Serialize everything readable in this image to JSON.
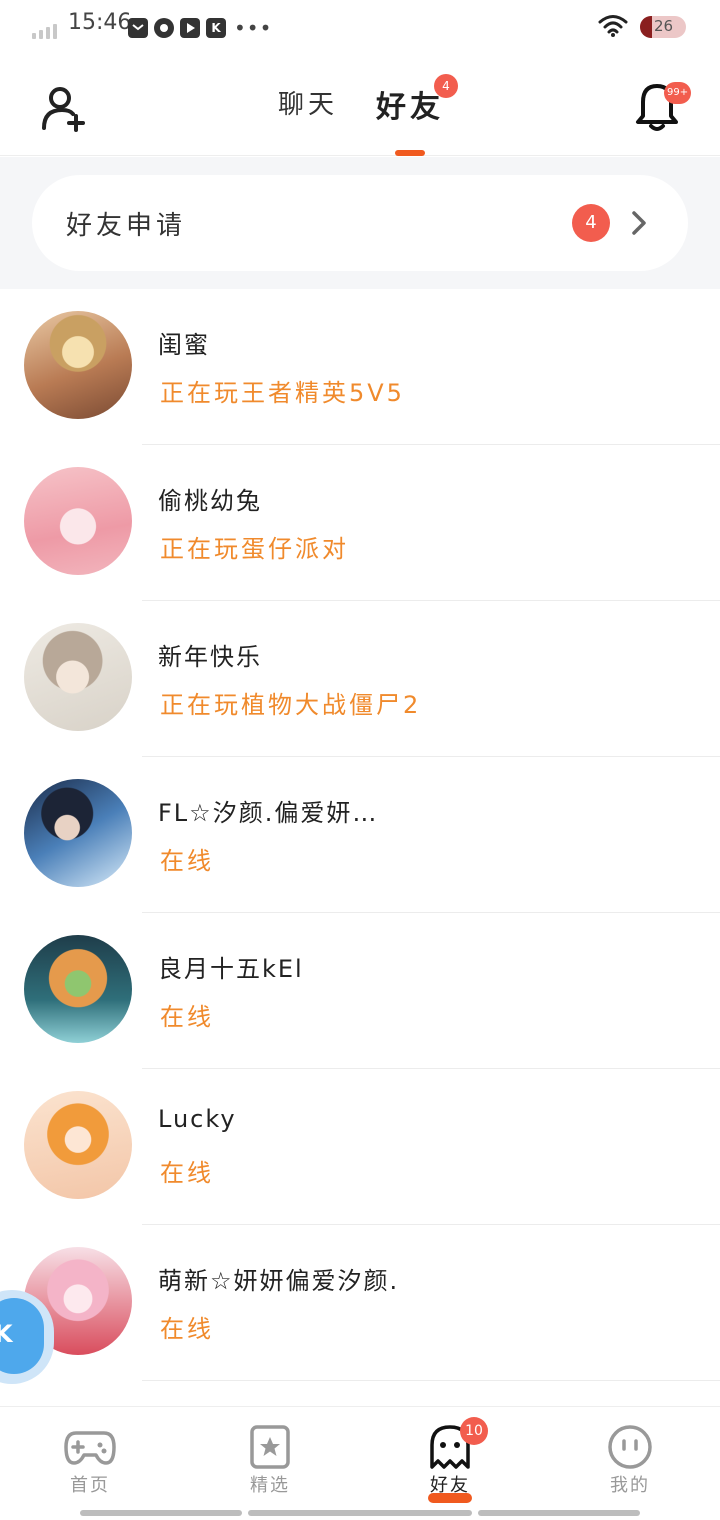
{
  "status_bar": {
    "time": "15:46",
    "battery_level": "26",
    "notif_icons": [
      "message-app-icon",
      "game-app-icon",
      "video-app-icon",
      "k-app-icon"
    ],
    "notif_k_letter": "K",
    "more": "•••"
  },
  "header": {
    "tabs": [
      {
        "label": "聊天",
        "active": false
      },
      {
        "label": "好友",
        "active": true,
        "badge": "4"
      }
    ],
    "bell_badge": "99+",
    "accent_color": "#f05a1f",
    "badge_color": "#f25d4e"
  },
  "friend_request": {
    "label": "好友申请",
    "count": "4"
  },
  "friends": [
    {
      "name": "闺蜜",
      "status": "正在玩王者精英5V5"
    },
    {
      "name": "偷桃幼兔",
      "status": "正在玩蛋仔派对"
    },
    {
      "name": "新年快乐",
      "status": "正在玩植物大战僵尸2"
    },
    {
      "name": "FL☆汐颜.偏爱妍…",
      "status": "在线"
    },
    {
      "name": "良月十五kEl",
      "status": "在线"
    },
    {
      "name": "Lucky",
      "status": "在线"
    },
    {
      "name": "萌新☆妍妍偏爱汐颜.",
      "status": "在线"
    }
  ],
  "float_button_glyph": "K",
  "bottom_nav": [
    {
      "label": "首页",
      "icon": "gamepad-icon",
      "active": false
    },
    {
      "label": "精选",
      "icon": "star-icon",
      "active": false
    },
    {
      "label": "好友",
      "icon": "ghost-icon",
      "active": true,
      "badge": "10"
    },
    {
      "label": "我的",
      "icon": "face-icon",
      "active": false
    }
  ]
}
